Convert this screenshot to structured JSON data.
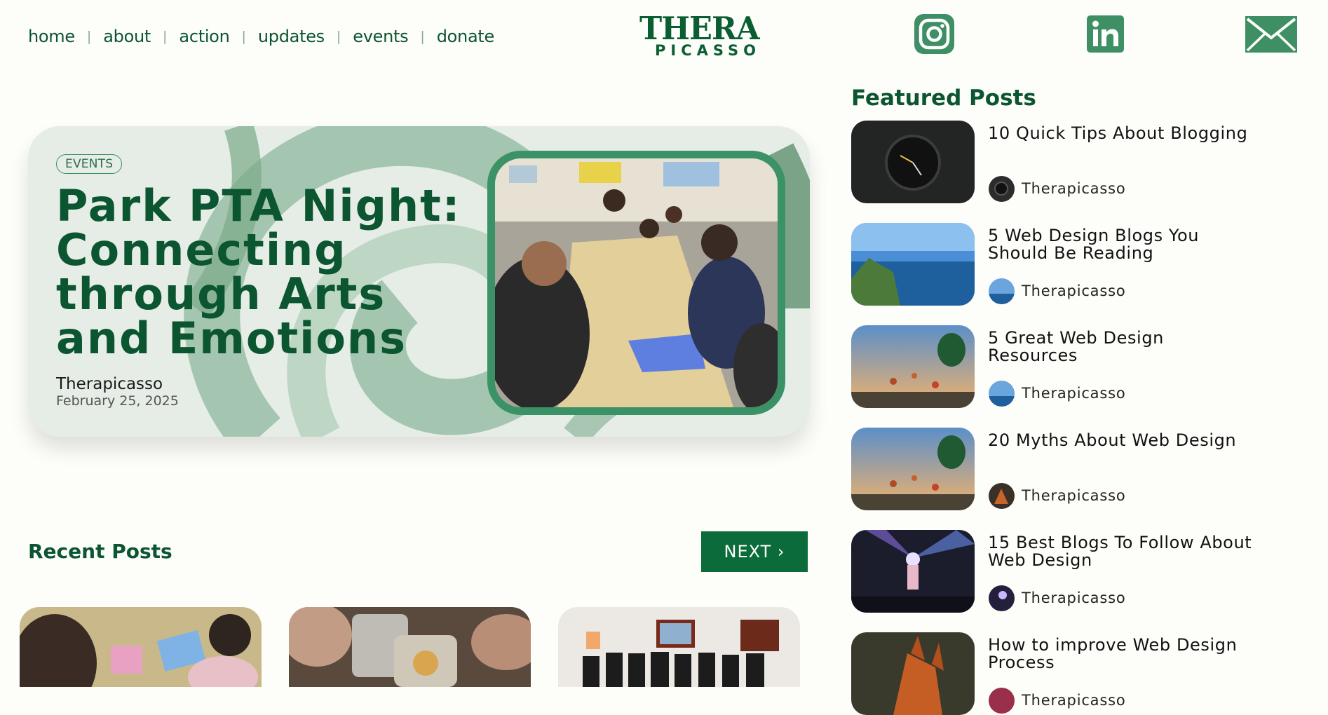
{
  "nav": {
    "items": [
      "home",
      "about",
      "action",
      "updates",
      "events",
      "donate"
    ]
  },
  "logo": {
    "line1": "THERA",
    "line2": "PICASSO"
  },
  "social": [
    "instagram-icon",
    "linkedin-icon",
    "mail-icon"
  ],
  "hero": {
    "badge": "EVENTS",
    "title": "Park PTA Night: Connecting through Arts and Emotions",
    "author": "Therapicasso",
    "date": "February 25, 2025"
  },
  "recent": {
    "heading": "Recent Posts",
    "next_label": "NEXT ›"
  },
  "featured": {
    "heading": "Featured Posts",
    "items": [
      {
        "title": "10 Quick Tips About Blogging",
        "author": "Therapicasso"
      },
      {
        "title": "5 Web Design Blogs You Should Be Reading",
        "author": "Therapicasso"
      },
      {
        "title": "5 Great Web Design Resources",
        "author": "Therapicasso"
      },
      {
        "title": "20 Myths About Web Design",
        "author": "Therapicasso"
      },
      {
        "title": "15 Best Blogs To Follow About Web Design",
        "author": "Therapicasso"
      },
      {
        "title": "How to improve Web Design Process",
        "author": "Therapicasso"
      }
    ]
  },
  "colors": {
    "brand": "#0b5530",
    "accent": "#3a9266",
    "button": "#0c6b3a",
    "hero_bg": "#e5ede6"
  }
}
